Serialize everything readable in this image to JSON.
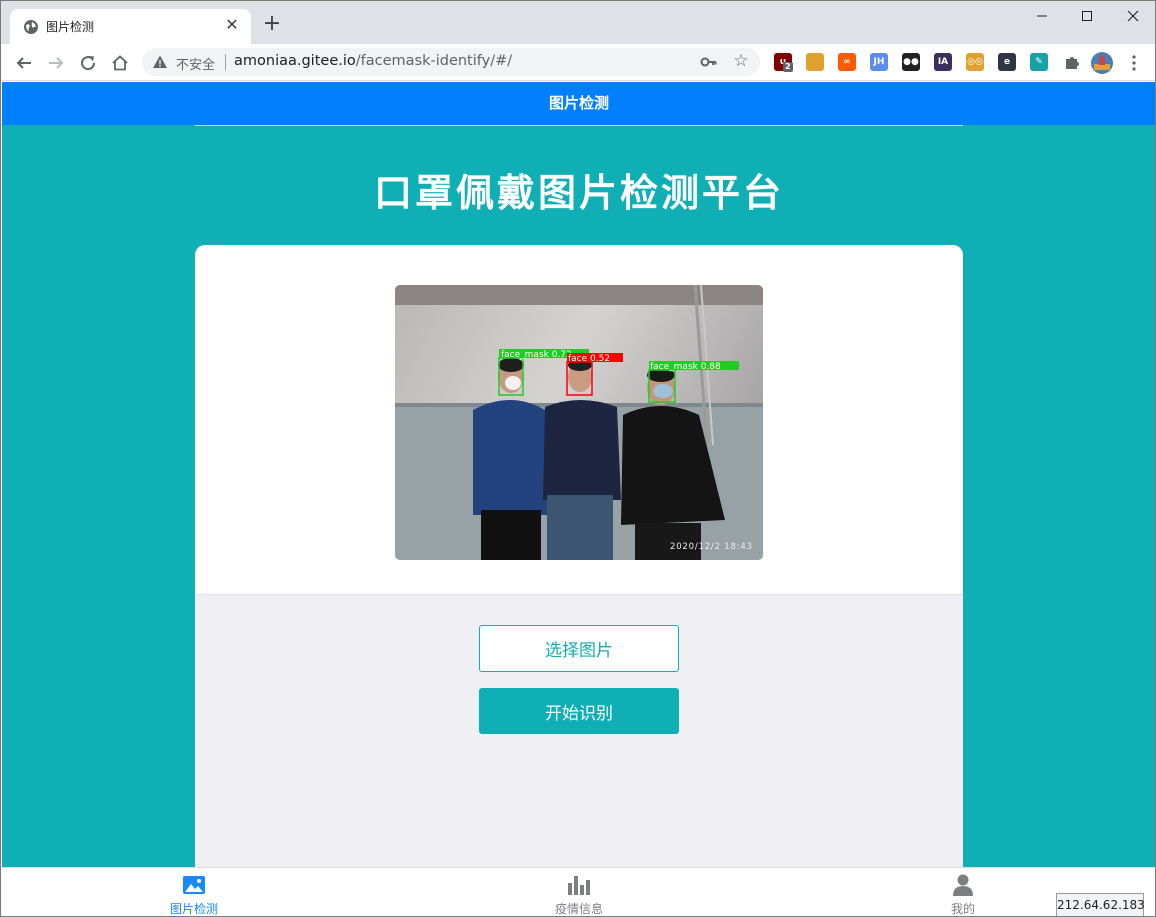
{
  "browser": {
    "tab_title": "图片检测",
    "new_tab": "+",
    "close_tab": "✕",
    "omnibox": {
      "security_label": "不安全",
      "url_host": "amoniaa.gitee.io",
      "url_path": "/facemask-identify/#/"
    },
    "extensions": [
      {
        "name": "ublock-extension",
        "text": "u",
        "color": "#800000"
      },
      {
        "name": "colorful-extension",
        "text": "",
        "color": "#e0a030"
      },
      {
        "name": "infinity-extension",
        "text": "∞",
        "color": "#ff5a00"
      },
      {
        "name": "jh-extension",
        "text": "JH",
        "color": "#5b8def"
      },
      {
        "name": "tampermonkey-extension",
        "text": "●●",
        "color": "#222222"
      },
      {
        "name": "ia-extension",
        "text": "IA",
        "color": "#3b2f5e"
      },
      {
        "name": "glasses-extension",
        "text": "◎◎",
        "color": "#e0a030"
      },
      {
        "name": "e-extension",
        "text": "e",
        "color": "#2f3542"
      },
      {
        "name": "eyedropper-extension",
        "text": "✎",
        "color": "#16a2a6"
      }
    ],
    "ublock_badge": "2",
    "status_bubble": "212.64.62.183"
  },
  "app": {
    "header_title": "图片检测",
    "main_title": "口罩佩戴图片检测平台",
    "select_button": "选择图片",
    "start_button": "开始识别",
    "detections": [
      {
        "label": "face_mask 0.72",
        "color": "#22cc22"
      },
      {
        "label": "face 0.52",
        "color": "#ff0000"
      },
      {
        "label": "face_mask 0.88",
        "color": "#22cc22"
      }
    ],
    "photo_timestamp": "2020/12/2 18:43",
    "tabbar": [
      {
        "label": "图片检测",
        "icon": "image-icon",
        "active": true
      },
      {
        "label": "疫情信息",
        "icon": "bar-chart-icon",
        "active": false
      },
      {
        "label": "我的",
        "icon": "user-icon",
        "active": false
      }
    ]
  },
  "colors": {
    "brand_teal": "#10aeb5",
    "header_blue": "#0080ff",
    "tab_active_blue": "#1989fa"
  }
}
